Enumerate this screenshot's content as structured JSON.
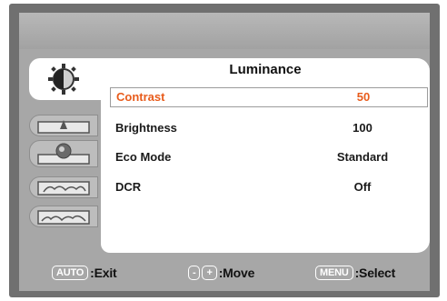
{
  "osd": {
    "title": "Luminance",
    "sidebar": [
      {
        "icon": "luminance-icon",
        "active": true
      },
      {
        "icon": "image-setup-icon",
        "active": false
      },
      {
        "icon": "color-temp-icon",
        "active": false
      },
      {
        "icon": "image-setting-icon",
        "active": false
      },
      {
        "icon": "misc-setting-icon",
        "active": false
      }
    ],
    "items": [
      {
        "label": "Contrast",
        "value": "50",
        "selected": true
      },
      {
        "label": "Brightness",
        "value": "100",
        "selected": false
      },
      {
        "label": "Eco Mode",
        "value": "Standard",
        "selected": false
      },
      {
        "label": "DCR",
        "value": "Off",
        "selected": false
      }
    ],
    "footer": {
      "exit_key": "AUTO",
      "exit_label": ":Exit",
      "minus_key": "-",
      "plus_key": "+",
      "move_label": ":Move",
      "menu_key": "MENU",
      "select_label": ":Select"
    },
    "colors": {
      "selected_text": "#e85c1c",
      "panel": "#ffffff",
      "frame": "#a7a7a7"
    }
  }
}
